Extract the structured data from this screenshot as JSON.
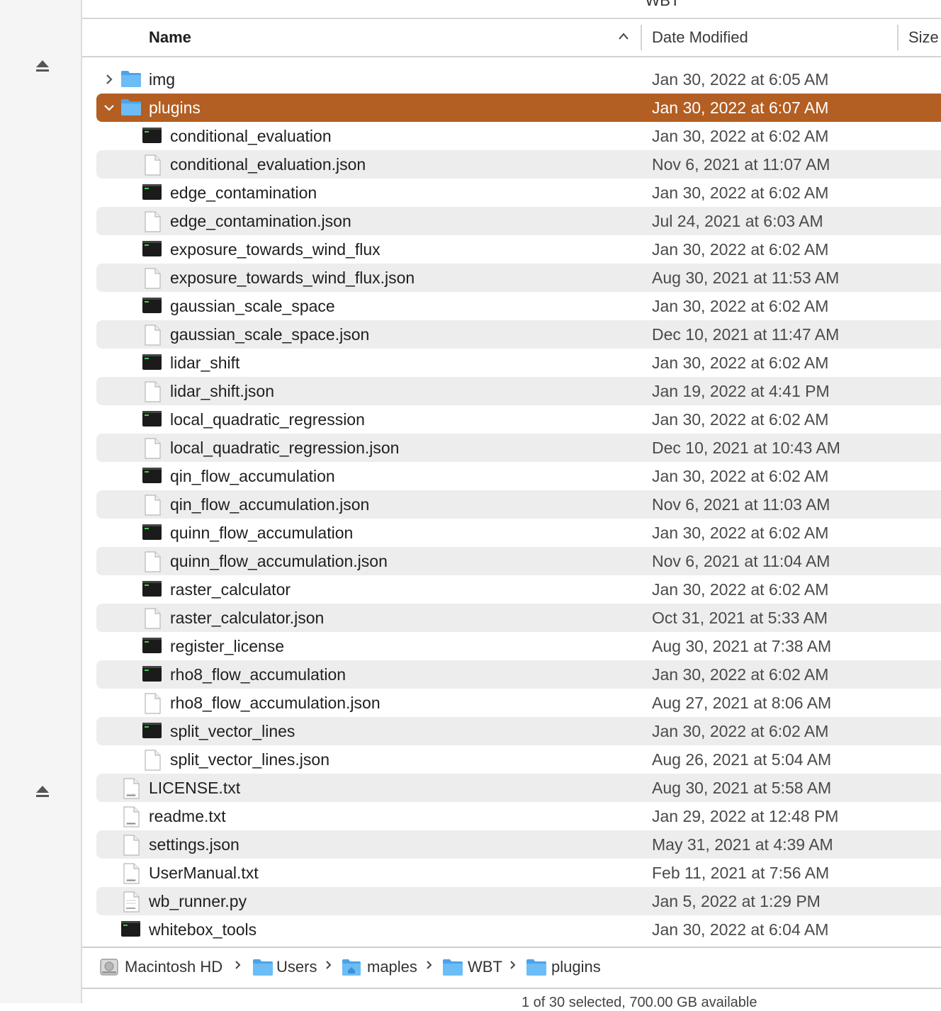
{
  "window": {
    "title": "WBT"
  },
  "columns": {
    "name": "Name",
    "date": "Date Modified",
    "size": "Size"
  },
  "rows": [
    {
      "name": "img",
      "date": "Jan 30, 2022 at 6:05 AM",
      "icon": "folder-icon",
      "disclosure": "collapsed"
    },
    {
      "name": "plugins",
      "date": "Jan 30, 2022 at 6:07 AM",
      "icon": "folder-icon",
      "disclosure": "expanded",
      "selected": true
    },
    {
      "name": "conditional_evaluation",
      "date": "Jan 30, 2022 at 6:02 AM",
      "icon": "exec-icon"
    },
    {
      "name": "conditional_evaluation.json",
      "date": "Nov 6, 2021 at 11:07 AM",
      "icon": "document-icon"
    },
    {
      "name": "edge_contamination",
      "date": "Jan 30, 2022 at 6:02 AM",
      "icon": "exec-icon"
    },
    {
      "name": "edge_contamination.json",
      "date": "Jul 24, 2021 at 6:03 AM",
      "icon": "document-icon"
    },
    {
      "name": "exposure_towards_wind_flux",
      "date": "Jan 30, 2022 at 6:02 AM",
      "icon": "exec-icon"
    },
    {
      "name": "exposure_towards_wind_flux.json",
      "date": "Aug 30, 2021 at 11:53 AM",
      "icon": "document-icon"
    },
    {
      "name": "gaussian_scale_space",
      "date": "Jan 30, 2022 at 6:02 AM",
      "icon": "exec-icon"
    },
    {
      "name": "gaussian_scale_space.json",
      "date": "Dec 10, 2021 at 11:47 AM",
      "icon": "document-icon"
    },
    {
      "name": "lidar_shift",
      "date": "Jan 30, 2022 at 6:02 AM",
      "icon": "exec-icon"
    },
    {
      "name": "lidar_shift.json",
      "date": "Jan 19, 2022 at 4:41 PM",
      "icon": "document-icon"
    },
    {
      "name": "local_quadratic_regression",
      "date": "Jan 30, 2022 at 6:02 AM",
      "icon": "exec-icon"
    },
    {
      "name": "local_quadratic_regression.json",
      "date": "Dec 10, 2021 at 10:43 AM",
      "icon": "document-icon"
    },
    {
      "name": "qin_flow_accumulation",
      "date": "Jan 30, 2022 at 6:02 AM",
      "icon": "exec-icon"
    },
    {
      "name": "qin_flow_accumulation.json",
      "date": "Nov 6, 2021 at 11:03 AM",
      "icon": "document-icon"
    },
    {
      "name": "quinn_flow_accumulation",
      "date": "Jan 30, 2022 at 6:02 AM",
      "icon": "exec-icon"
    },
    {
      "name": "quinn_flow_accumulation.json",
      "date": "Nov 6, 2021 at 11:04 AM",
      "icon": "document-icon"
    },
    {
      "name": "raster_calculator",
      "date": "Jan 30, 2022 at 6:02 AM",
      "icon": "exec-icon"
    },
    {
      "name": "raster_calculator.json",
      "date": "Oct 31, 2021 at 5:33 AM",
      "icon": "document-icon"
    },
    {
      "name": "register_license",
      "date": "Aug 30, 2021 at 7:38 AM",
      "icon": "exec-icon"
    },
    {
      "name": "rho8_flow_accumulation",
      "date": "Jan 30, 2022 at 6:02 AM",
      "icon": "exec-icon"
    },
    {
      "name": "rho8_flow_accumulation.json",
      "date": "Aug 27, 2021 at 8:06 AM",
      "icon": "document-icon"
    },
    {
      "name": "split_vector_lines",
      "date": "Jan 30, 2022 at 6:02 AM",
      "icon": "exec-icon"
    },
    {
      "name": "split_vector_lines.json",
      "date": "Aug 26, 2021 at 5:04 AM",
      "icon": "document-icon"
    },
    {
      "name": "LICENSE.txt",
      "date": "Aug 30, 2021 at 5:58 AM",
      "icon": "text-file-icon"
    },
    {
      "name": "readme.txt",
      "date": "Jan 29, 2022 at 12:48 PM",
      "icon": "text-file-icon"
    },
    {
      "name": "settings.json",
      "date": "May 31, 2021 at 4:39 AM",
      "icon": "document-icon"
    },
    {
      "name": "UserManual.txt",
      "date": "Feb 11, 2021 at 7:56 AM",
      "icon": "text-file-icon"
    },
    {
      "name": "wb_runner.py",
      "date": "Jan 5, 2022 at 1:29 PM",
      "icon": "python-file-icon"
    },
    {
      "name": "whitebox_tools",
      "date": "Jan 30, 2022 at 6:04 AM",
      "icon": "exec-icon"
    }
  ],
  "pathbar": [
    {
      "label": "Macintosh HD",
      "icon": "disk-icon"
    },
    {
      "label": "Users",
      "icon": "folder-icon"
    },
    {
      "label": "maples",
      "icon": "home-folder-icon"
    },
    {
      "label": "WBT",
      "icon": "folder-icon"
    },
    {
      "label": "plugins",
      "icon": "folder-icon"
    }
  ],
  "status": "1 of 30 selected, 700.00 GB available",
  "colors": {
    "selection": "#b35e22",
    "folder": "#5aaef0",
    "alt_row": "#ededed"
  }
}
